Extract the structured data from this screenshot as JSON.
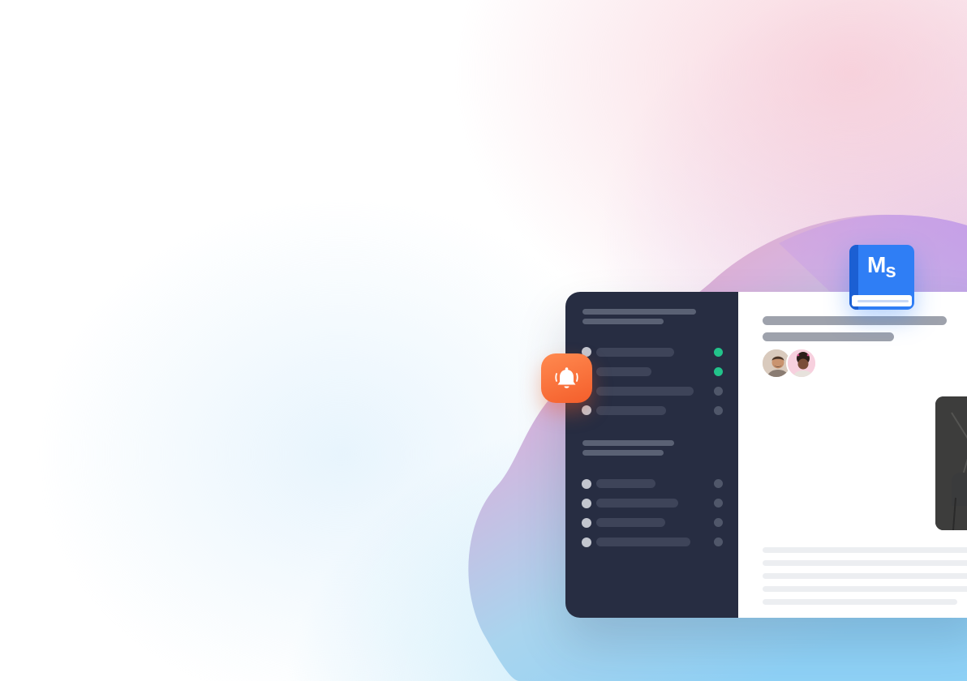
{
  "logo": {
    "primary": "M",
    "secondary": "s"
  },
  "colors": {
    "sidebar": "#272d42",
    "status_online": "#22c38a",
    "status_offline": "#50576a",
    "notify_orange": "#f45e2b",
    "brand_blue": "#2f7ef5",
    "play_red": "#ee4a43"
  },
  "icons": {
    "notification": "bell-ringing-icon",
    "logo": "ms-book-icon",
    "play": "play-icon"
  },
  "sidebar": {
    "section_1_items": [
      {
        "status": "online"
      },
      {
        "status": "online"
      },
      {
        "status": "offline"
      },
      {
        "status": "offline"
      }
    ],
    "section_2_items": [
      {
        "status": "offline"
      },
      {
        "status": "offline"
      },
      {
        "status": "offline"
      },
      {
        "status": "offline"
      }
    ]
  },
  "participants": [
    {
      "avatar": "man-avatar"
    },
    {
      "avatar": "woman-avatar"
    }
  ]
}
